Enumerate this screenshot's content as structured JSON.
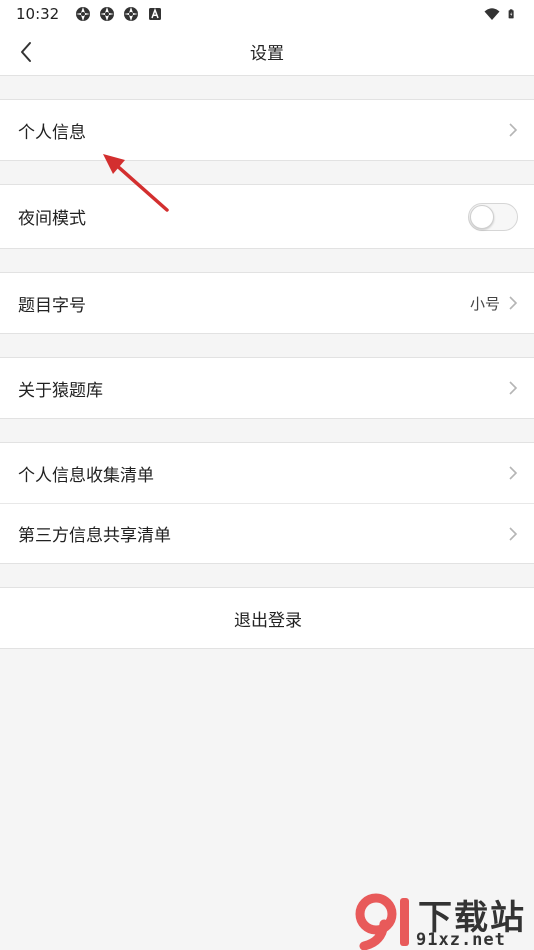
{
  "status_bar": {
    "time": "10:32",
    "left_icons": [
      "aperture-icon",
      "aperture-icon",
      "aperture-icon",
      "a-badge-icon"
    ],
    "right_icons": [
      "wifi-icon",
      "battery-icon"
    ]
  },
  "nav": {
    "back_icon": "chevron-left-icon",
    "title": "设置"
  },
  "groups": {
    "personal_info": {
      "label": "个人信息"
    },
    "night_mode": {
      "label": "夜间模式",
      "enabled": false
    },
    "font_size": {
      "label": "题目字号",
      "value": "小号"
    },
    "about": {
      "label": "关于猿题库"
    },
    "info_list": {
      "label": "个人信息收集清单"
    },
    "third_party": {
      "label": "第三方信息共享清单"
    },
    "logout": {
      "label": "退出登录"
    }
  },
  "watermark": {
    "logo_text": "下载站",
    "site": "91xz.net"
  },
  "colors": {
    "background": "#f5f5f5",
    "surface": "#ffffff",
    "annotation_arrow": "#d32f2f",
    "watermark_logo": "#e85a5a"
  }
}
